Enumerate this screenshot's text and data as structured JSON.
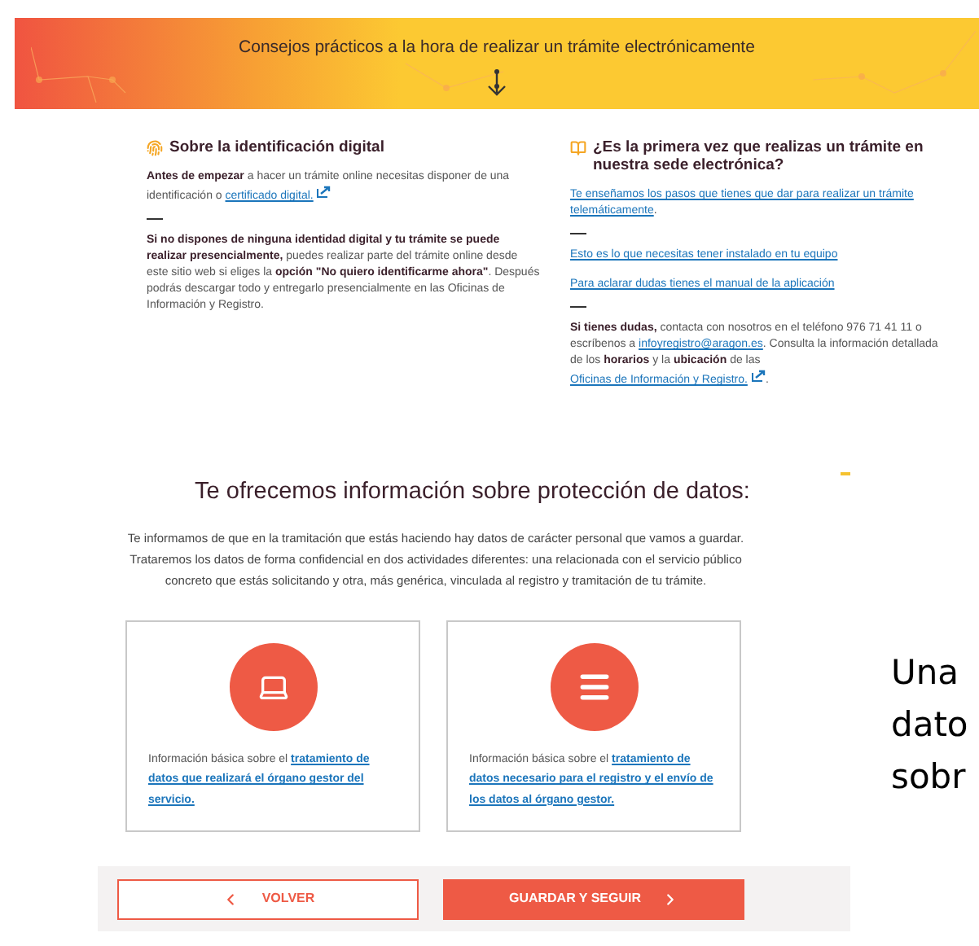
{
  "banner": {
    "title": "Consejos prácticos a la hora de realizar un trámite electrónicamente"
  },
  "left_column": {
    "heading": "Sobre la identificación digital",
    "paragraphs": [
      {
        "divider_before": false,
        "parts": [
          {
            "kind": "text",
            "text": "**Antes de empezar** a hacer un trámite online necesitas disponer de una identificación o "
          },
          {
            "kind": "link",
            "text": "certificado digital.",
            "external": true
          }
        ]
      },
      {
        "divider_before": true,
        "parts": [
          {
            "kind": "text",
            "text": "**Si no dispones de ninguna identidad digital y tu trámite se puede realizar presencialmente,** puedes realizar parte del trámite online desde este sitio web si eliges la **opción \"No quiero identificarme ahora\"**. Después podrás descargar todo y entregarlo presencialmente en las Oficinas de Información y Registro."
          }
        ]
      }
    ]
  },
  "right_column": {
    "heading": "¿Es la primera vez que realizas un trámite en nuestra sede electrónica?",
    "paragraphs": [
      {
        "divider_before": false,
        "parts": [
          {
            "kind": "link",
            "text": "Te enseñamos los pasos que tienes que dar para realizar un trámite telemáticamente",
            "external": false
          },
          {
            "kind": "text",
            "text": "."
          }
        ]
      },
      {
        "divider_before": true,
        "parts": [
          {
            "kind": "link",
            "text": "Esto es lo que necesitas tener instalado en tu equipo",
            "external": false
          }
        ]
      },
      {
        "divider_before": false,
        "parts": [
          {
            "kind": "link",
            "text": "Para aclarar dudas tienes el manual de la aplicación",
            "external": false
          }
        ]
      },
      {
        "divider_before": true,
        "parts": [
          {
            "kind": "text",
            "text": "**Si tienes dudas,** contacta con nosotros en el teléfono 976 71 41 11 o escríbenos a "
          },
          {
            "kind": "link",
            "text": "infoyregistro@aragon.es",
            "external": false
          },
          {
            "kind": "text",
            "text": ". Consulta la información detallada de los **horarios** y la **ubicación** de las "
          },
          {
            "kind": "link",
            "text": "Oficinas de Información y Registro.",
            "external": true
          },
          {
            "kind": "text",
            "text": "."
          }
        ]
      }
    ]
  },
  "protection": {
    "title": "Te ofrecemos información sobre protección de datos:",
    "intro": "Te informamos de que en la tramitación que estás haciendo hay datos de carácter personal que vamos a guardar. Trataremos los datos de forma confidencial en dos actividades diferentes: una relacionada con el servicio público concreto que estás solicitando y otra, más genérica, vinculada al registro y tramitación de tu trámite.",
    "cards": [
      {
        "text": "Información básica sobre el ",
        "link": "tratamiento de datos que realizará el órgano gestor del servicio."
      },
      {
        "text": "Información básica sobre el ",
        "link": "tratamiento de datos necesario para el registro y el envío de los datos al órgano gestor."
      }
    ]
  },
  "side_text": [
    "Una",
    "dato",
    "sobr"
  ],
  "buttons": [
    {
      "kind": "back",
      "label": "VOLVER"
    },
    {
      "kind": "next",
      "label": "GUARDAR Y SEGUIR"
    }
  ]
}
